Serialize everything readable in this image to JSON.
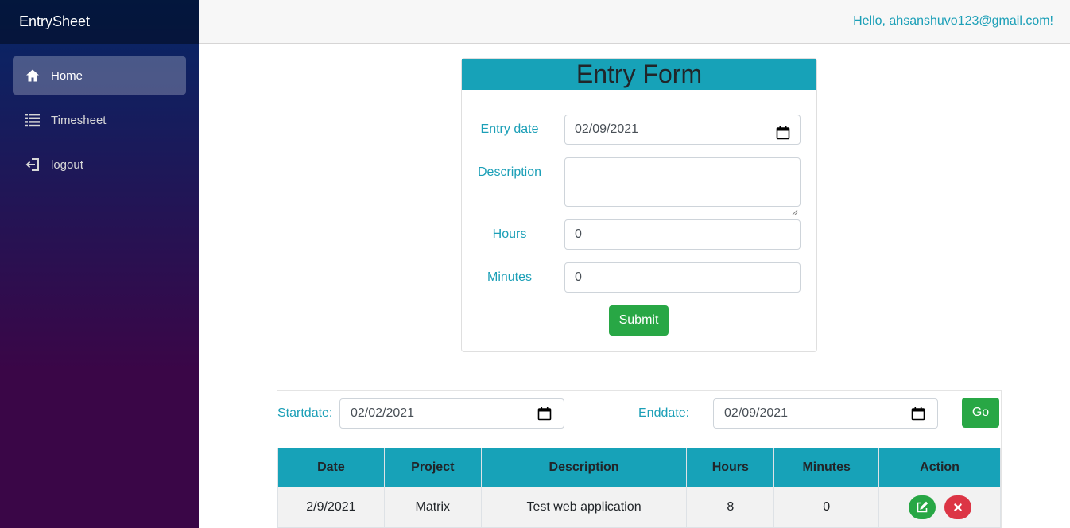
{
  "brand": "EntrySheet",
  "nav": [
    {
      "label": "Home",
      "icon": "home-icon",
      "active": true
    },
    {
      "label": "Timesheet",
      "icon": "list-icon",
      "active": false
    },
    {
      "label": "logout",
      "icon": "logout-icon",
      "active": false
    }
  ],
  "topbar": {
    "greeting": "Hello, ahsanshuvo123@gmail.com!"
  },
  "entry_form": {
    "title": "Entry Form",
    "entry_date_label": "Entry date",
    "entry_date_value": "02/09/2021",
    "description_label": "Description",
    "description_value": "",
    "hours_label": "Hours",
    "hours_value": "0",
    "minutes_label": "Minutes",
    "minutes_value": "0",
    "submit_label": "Submit"
  },
  "filter": {
    "startdate_label": "Startdate:",
    "startdate_value": "02/02/2021",
    "enddate_label": "Enddate:",
    "enddate_value": "02/09/2021",
    "go_label": "Go"
  },
  "table": {
    "headers": [
      "Date",
      "Project",
      "Description",
      "Hours",
      "Minutes",
      "Action"
    ],
    "rows": [
      {
        "date": "2/9/2021",
        "project": "Matrix",
        "description": "Test web application",
        "hours": "8",
        "minutes": "0"
      }
    ]
  },
  "colors": {
    "accent": "#17a2b8",
    "link": "#1b9fb7",
    "success": "#28a745",
    "danger": "#dc3545",
    "sidebar_top": "#052767",
    "sidebar_bottom": "#3a0647"
  }
}
